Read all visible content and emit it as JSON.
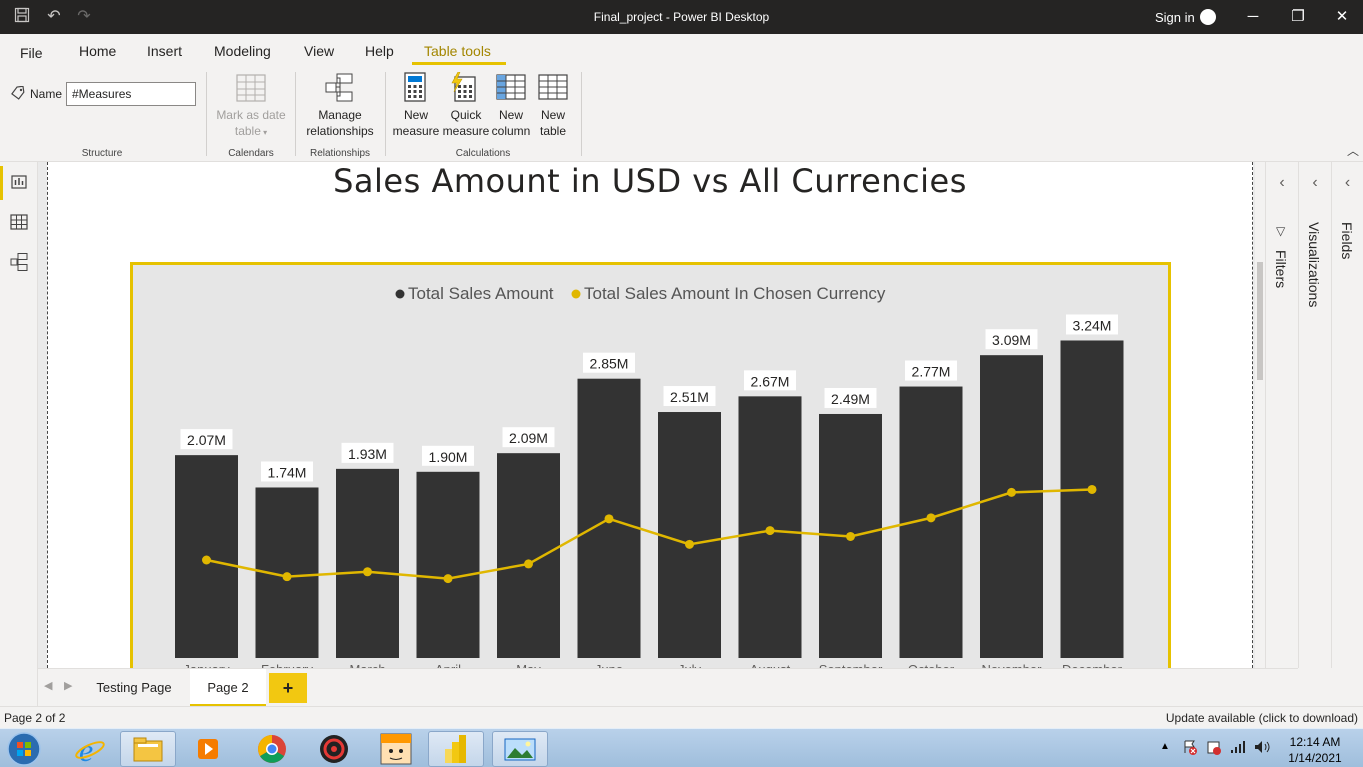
{
  "window": {
    "title": "Final_project - Power BI Desktop",
    "sign_in": "Sign in",
    "minimize": "─",
    "restore": "❐",
    "close": "✕"
  },
  "menu": {
    "file": "File",
    "home": "Home",
    "insert": "Insert",
    "modeling": "Modeling",
    "view": "View",
    "help": "Help",
    "table_tools": "Table tools"
  },
  "ribbon": {
    "name_label": "Name",
    "name_value": "#Measures",
    "structure_label": "Structure",
    "mark_as_date_line1": "Mark as date",
    "mark_as_date_line2": "table",
    "calendars_label": "Calendars",
    "manage_line1": "Manage",
    "manage_line2": "relationships",
    "relationships_label": "Relationships",
    "new_measure_line1": "New",
    "new_measure_line2": "measure",
    "quick_measure_line1": "Quick",
    "quick_measure_line2": "measure",
    "new_column_line1": "New",
    "new_column_line2": "column",
    "new_table_line1": "New",
    "new_table_line2": "table",
    "calculations_label": "Calculations"
  },
  "report": {
    "page_title": "Sales Amount in USD vs All Currencies"
  },
  "panes": {
    "filters": "Filters",
    "visualizations": "Visualizations",
    "fields": "Fields"
  },
  "pages": {
    "tab1": "Testing Page",
    "tab2": "Page 2",
    "add": "+"
  },
  "status": {
    "page_indicator": "Page 2 of 2",
    "update": "Update available (click to download)"
  },
  "taskbar": {
    "time": "12:14 AM",
    "date": "1/14/2021"
  },
  "colors": {
    "accent": "#F2C811",
    "bar": "#333333",
    "line": "#E0B700"
  },
  "chart_data": {
    "type": "bar",
    "categories": [
      "January",
      "February",
      "March",
      "April",
      "May",
      "June",
      "July",
      "August",
      "September",
      "October",
      "November",
      "December"
    ],
    "series": [
      {
        "name": "Total Sales Amount",
        "type": "bar",
        "values": [
          2.07,
          1.74,
          1.93,
          1.9,
          2.09,
          2.85,
          2.51,
          2.67,
          2.49,
          2.77,
          3.09,
          3.24
        ],
        "labels": [
          "2.07M",
          "1.74M",
          "1.93M",
          "1.90M",
          "2.09M",
          "2.85M",
          "2.51M",
          "2.67M",
          "2.49M",
          "2.77M",
          "3.09M",
          "3.24M"
        ]
      },
      {
        "name": "Total Sales Amount In Chosen Currency",
        "type": "line",
        "values": [
          1.0,
          0.83,
          0.88,
          0.81,
          0.96,
          1.42,
          1.16,
          1.3,
          1.24,
          1.43,
          1.69,
          1.72
        ]
      }
    ],
    "ylim": [
      0,
      3.5
    ],
    "legend_position": "top-center",
    "grid": false
  }
}
